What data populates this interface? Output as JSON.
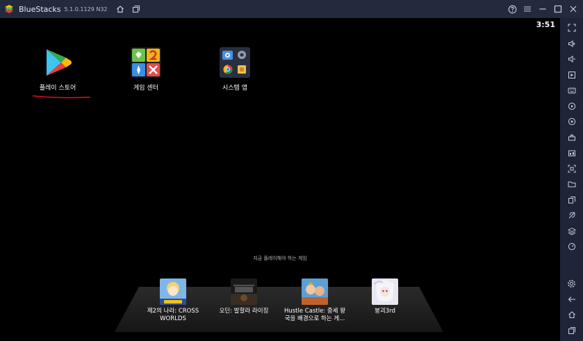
{
  "window": {
    "app_name": "BlueStacks",
    "version": "5.1.0.1129 N32"
  },
  "status": {
    "clock": "3:51"
  },
  "apps": [
    {
      "label": "플레이 스토어"
    },
    {
      "label": "게임 센터"
    },
    {
      "label": "시스템 앱"
    }
  ],
  "recent": {
    "label": "지금 플레이해야 하는 게임",
    "games": [
      {
        "name_line1": "제2의 나라: CROSS",
        "name_line2": "WORLDS"
      },
      {
        "name_line1": "오딘: 발할라 라이징",
        "name_line2": ""
      },
      {
        "name_line1": "Hustle Castle: 중세 왕",
        "name_line2": "국을 배경으로 하는 게..."
      },
      {
        "name_line1": "붕괴3rd",
        "name_line2": ""
      }
    ]
  },
  "colors": {
    "titlebar": "#232a3e",
    "sidebar": "#1f2538",
    "annotation_underline": "#e01010"
  }
}
